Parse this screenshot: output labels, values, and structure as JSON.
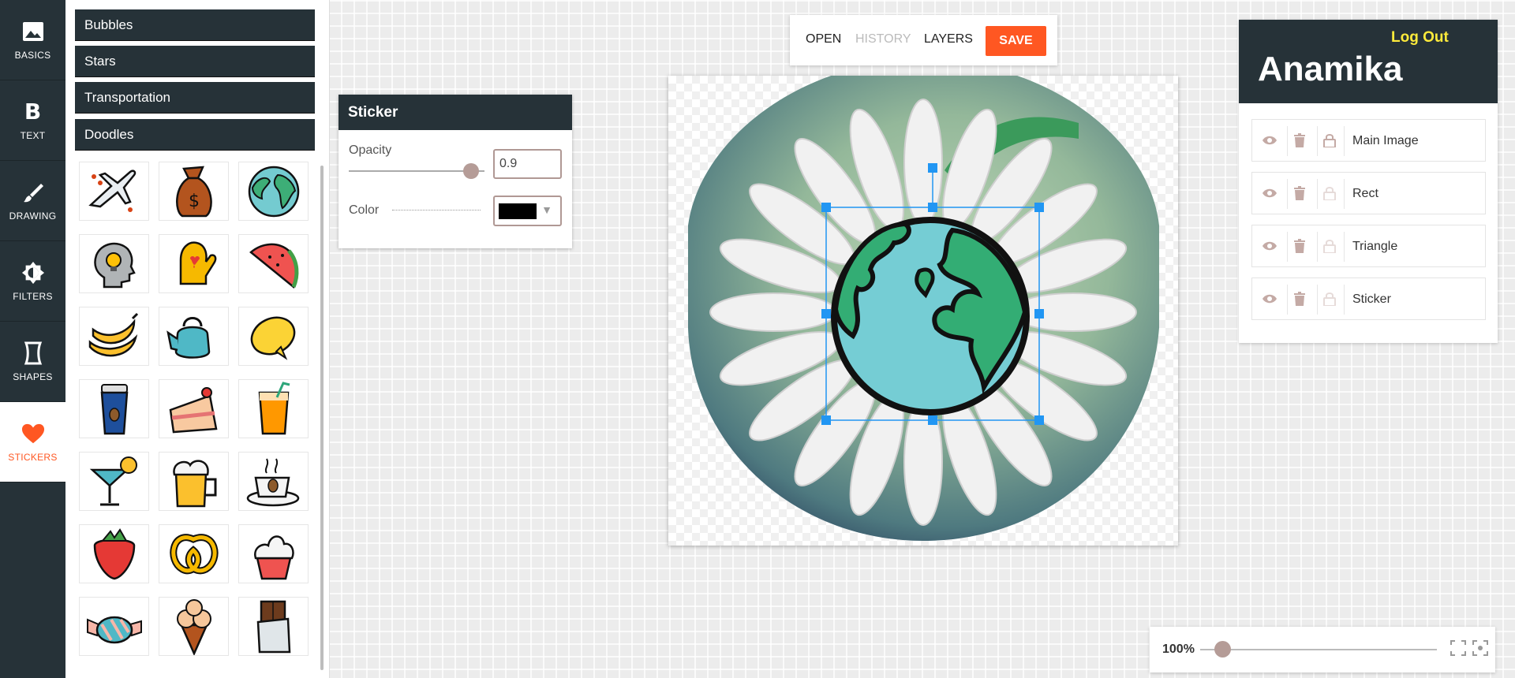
{
  "nav": {
    "items": [
      {
        "label": "BASICS",
        "icon": "image-icon"
      },
      {
        "label": "TEXT",
        "icon": "bold-text-icon"
      },
      {
        "label": "DRAWING",
        "icon": "brush-icon"
      },
      {
        "label": "FILTERS",
        "icon": "contrast-icon"
      },
      {
        "label": "SHAPES",
        "icon": "shape-icon"
      },
      {
        "label": "STICKERS",
        "icon": "heart-icon",
        "active": true
      }
    ]
  },
  "library": {
    "categories": [
      "Bubbles",
      "Stars",
      "Transportation",
      "Doodles"
    ],
    "stickers": [
      "airplane-sticker",
      "money-bag-sticker",
      "globe-sticker",
      "idea-head-sticker",
      "oven-mitt-sticker",
      "watermelon-sticker",
      "bananas-sticker",
      "teapot-sticker",
      "lemon-sticker",
      "coffee-cup-sticker",
      "cake-slice-sticker",
      "juice-glass-sticker",
      "cocktail-sticker",
      "beer-mug-sticker",
      "coffee-saucer-sticker",
      "strawberry-sticker",
      "pretzel-sticker",
      "cupcake-sticker",
      "candy-sticker",
      "ice-cream-sticker",
      "chocolate-bar-sticker"
    ]
  },
  "properties": {
    "title": "Sticker",
    "opacity_label": "Opacity",
    "opacity_value": "0.9",
    "color_label": "Color",
    "color_value": "#000000"
  },
  "toolbar": {
    "open": "OPEN",
    "history": "HISTORY",
    "layers": "LAYERS",
    "save": "SAVE"
  },
  "user": {
    "name": "Anamika",
    "logout": "Log Out"
  },
  "layers": [
    "Main Image",
    "Rect",
    "Triangle",
    "Sticker"
  ],
  "zoom": {
    "label": "100%",
    "level": 1.0
  },
  "colors": {
    "accent": "#ff5722",
    "dark": "#263238",
    "logout": "#ffeb3b",
    "selection": "#2196f3"
  }
}
